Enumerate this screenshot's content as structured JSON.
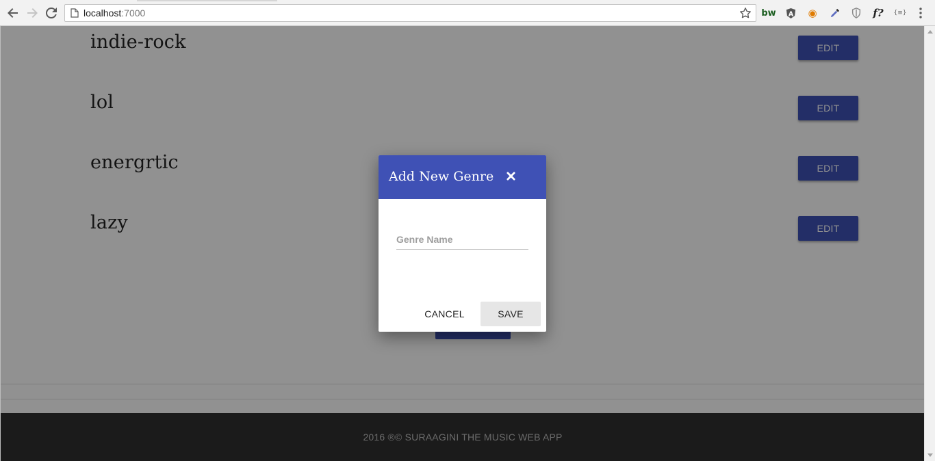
{
  "browser": {
    "url_host": "localhost",
    "url_port": ":7000",
    "back_icon": "back-arrow-icon",
    "forward_icon": "forward-arrow-icon",
    "reload_icon": "reload-icon",
    "bookmark_icon": "star-icon",
    "menu_icon": "kebab-menu-icon",
    "extensions": [
      {
        "name": "bw-extension-icon",
        "glyph": "bw",
        "color": "#1b5e20"
      },
      {
        "name": "angular-extension-icon",
        "glyph": "A",
        "color": "#555555"
      },
      {
        "name": "eye-extension-icon",
        "glyph": "◉",
        "color": "#e07b00"
      },
      {
        "name": "eyedropper-extension-icon",
        "glyph": "✎",
        "color": "#3a3a6a"
      },
      {
        "name": "shield-extension-icon",
        "glyph": "⛨",
        "color": "#777777"
      },
      {
        "name": "font-extension-icon",
        "glyph": "f?",
        "color": "#222222"
      },
      {
        "name": "json-extension-icon",
        "glyph": "{≡}",
        "color": "#666666"
      }
    ]
  },
  "genres": [
    {
      "name": "indie-rock",
      "edit_label": "EDIT"
    },
    {
      "name": "lol",
      "edit_label": "EDIT"
    },
    {
      "name": "energrtic",
      "edit_label": "EDIT"
    },
    {
      "name": "lazy",
      "edit_label": "EDIT"
    }
  ],
  "footer": {
    "text": "2016 ®© SURAAGINI THE MUSIC WEB APP"
  },
  "modal": {
    "title": "Add New Genre",
    "close_icon": "close-icon",
    "genre_input": {
      "placeholder": "Genre Name",
      "value": ""
    },
    "cancel_label": "CANCEL",
    "save_label": "SAVE"
  },
  "colors": {
    "primary": "#3f51b5",
    "footer_bg": "#303030",
    "overlay": "rgba(0,0,0,0.43)"
  }
}
